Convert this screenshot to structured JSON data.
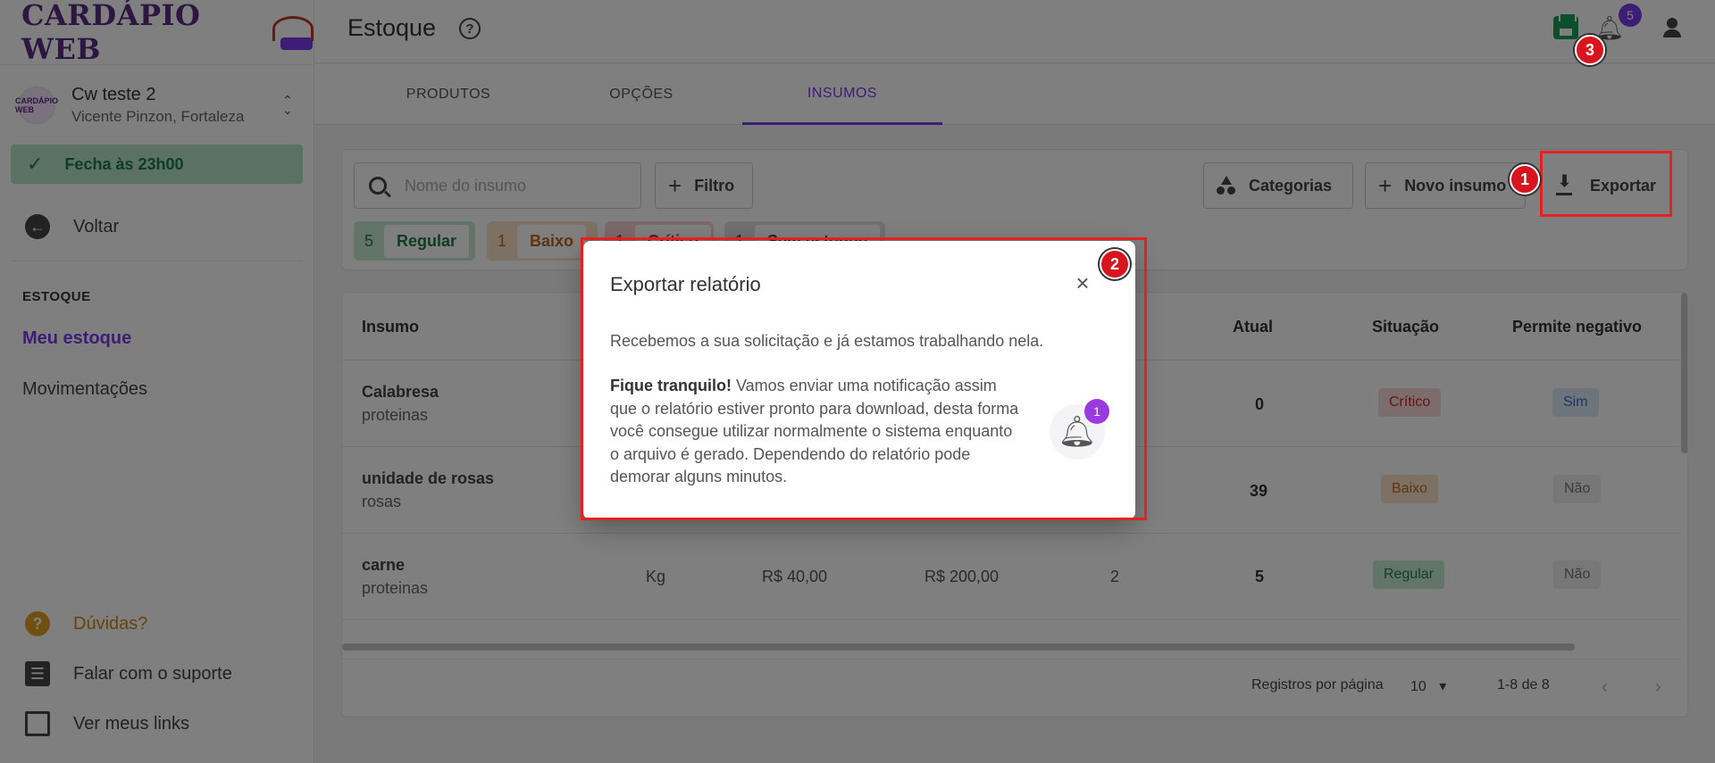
{
  "sidebar": {
    "logo_text": "CARDÁPIO WEB",
    "store": {
      "name": "Cw teste 2",
      "address": "Vicente Pinzon, Fortaleza",
      "avatar_text": "CARDÁPIO WEB"
    },
    "open_status": "Fecha às 23h00",
    "back_label": "Voltar",
    "section_title": "ESTOQUE",
    "nav": {
      "active": "Meu estoque",
      "item": "Movimentações"
    },
    "footer": {
      "help": "Dúvidas?",
      "support": "Falar com o suporte",
      "links": "Ver meus links"
    }
  },
  "header": {
    "title": "Estoque",
    "notifications_count": "5"
  },
  "tabs": [
    "PRODUTOS",
    "OPÇÕES",
    "INSUMOS"
  ],
  "toolbar": {
    "search_placeholder": "Nome do insumo",
    "filter_label": "Filtro",
    "categories_label": "Categorias",
    "new_label": "Novo insumo",
    "export_label": "Exportar"
  },
  "chips": [
    {
      "count": "5",
      "label": "Regular"
    },
    {
      "count": "1",
      "label": "Baixo"
    },
    {
      "count": "1",
      "label": "Crítico"
    },
    {
      "count": "1",
      "label": "Sem estoque"
    }
  ],
  "table": {
    "headers": {
      "insumo": "Insumo",
      "atual": "Atual",
      "situacao": "Situação",
      "permite": "Permite negativo"
    },
    "rows": [
      {
        "name": "Calabresa",
        "category": "proteinas",
        "unit": "",
        "cost": "",
        "total": "",
        "min": "",
        "current": "0",
        "status": "Crítico",
        "negative": "Sim"
      },
      {
        "name": "unidade de rosas",
        "category": "rosas",
        "unit": "",
        "cost": "",
        "total": "",
        "min": "",
        "current": "39",
        "status": "Baixo",
        "negative": "Não"
      },
      {
        "name": "carne",
        "category": "proteinas",
        "unit": "Kg",
        "cost": "R$ 40,00",
        "total": "R$ 200,00",
        "min": "2",
        "current": "5",
        "status": "Regular",
        "negative": "Não"
      }
    ],
    "pagination": {
      "label": "Registros por página",
      "per_page": "10",
      "range": "1-8 de 8"
    }
  },
  "modal": {
    "title": "Exportar relatório",
    "message": "Recebemos a sua solicitação e já estamos trabalhando nela.",
    "tip_bold": "Fique tranquilo!",
    "tip_text": "Vamos enviar uma notificação assim que o relatório estiver pronto para download, desta forma você consegue utilizar normalmente o sistema enquanto o arquivo é gerado. Dependendo do relatório pode demorar alguns minutos.",
    "bell_badge": "1"
  },
  "annotations": [
    "1",
    "2",
    "3"
  ],
  "colors": {
    "accent": "#7c3aed",
    "success": "#1e7b44",
    "warning": "#e0a020",
    "danger": "#d8151e"
  }
}
